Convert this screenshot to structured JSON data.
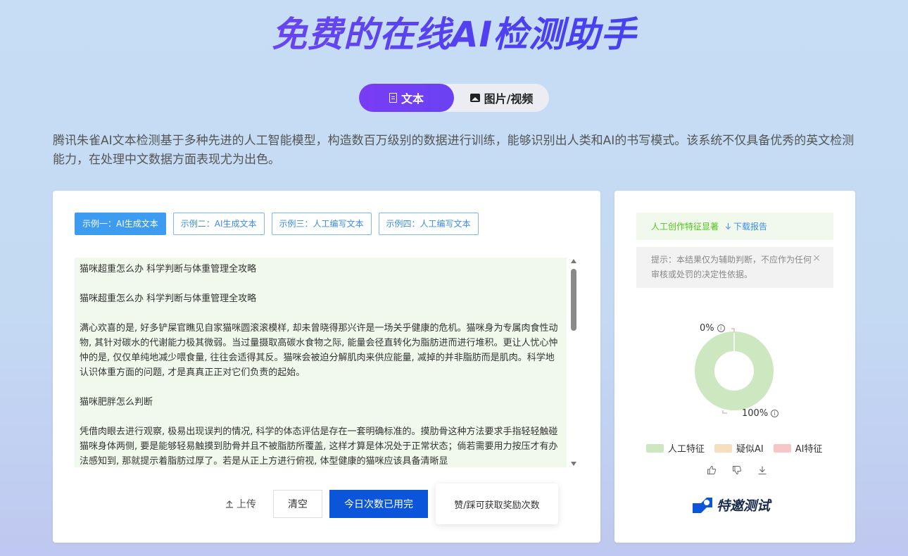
{
  "hero": {
    "title": "免费的在线AI检测助手"
  },
  "mode_tabs": [
    {
      "label": "文本",
      "icon": "document-icon",
      "active": true
    },
    {
      "label": "图片/视频",
      "icon": "image-icon",
      "active": false
    }
  ],
  "intro": "腾讯朱雀AI文本检测基于多种先进的人工智能模型，构造数百万级别的数据进行训练，能够识别出人类和AI的书写模式。该系统不仅具备优秀的英文检测能力，在处理中文数据方面表现尤为出色。",
  "examples": [
    {
      "label": "示例一：AI生成文本",
      "active": true
    },
    {
      "label": "示例二：AI生成文本",
      "active": false
    },
    {
      "label": "示例三：人工编写文本",
      "active": false
    },
    {
      "label": "示例四：人工编写文本",
      "active": false
    }
  ],
  "input_text": [
    "猫咪超重怎么办 科学判断与体重管理全攻略",
    "猫咪超重怎么办 科学判断与体重管理全攻略",
    "满心欢喜的是, 好多铲屎官瞧见自家猫咪圆滚滚模样, 却未曾晓得那兴许是一场关乎健康的危机。猫咪身为专属肉食性动物, 其针对碳水的代谢能力极其微弱。当过量摄取高碳水食物之际, 能量会径直转化为脂肪进而进行堆积。更让人忧心忡忡的是, 仅仅单纯地减少喂食量, 往往会适得其反。猫咪会被迫分解肌肉来供应能量, 减掉的并非脂肪而是肌肉。科学地认识体重方面的问题, 才是真真正正对它们负责的起始。",
    "猫咪肥胖怎么判断",
    "凭借肉眼去进行观察, 极易出现误判的情况, 科学的体态评估是存在一套明确标准的。摸肋骨这种方法要求手指轻轻触碰猫咪身体两侧, 要是能够轻易触摸到肋骨并且不被脂肪所覆盖, 这样才算是体况处于正常状态；倘若需要用力按压才有办法感知到, 那就提示着脂肪过厚了。若是从正上方进行俯视, 体型健康的猫咪应该具备清晰显"
  ],
  "actions": {
    "upload": "上传",
    "clear": "清空",
    "quota": "今日次数已用完",
    "reward_tip": "赞/踩可获取奖励次数"
  },
  "result": {
    "verdict": "人工创作特征显著",
    "download": "下载报告",
    "hint": "提示：本结果仅为辅助判断，不应作为任何审核或处罚的决定性依据。",
    "hint_close": "×",
    "ai_label": "0%",
    "human_label": "100%"
  },
  "legend": [
    {
      "label": "人工特征",
      "color": "#cde8c0"
    },
    {
      "label": "疑似AI",
      "color": "#f5dfbd"
    },
    {
      "label": "AI特征",
      "color": "#f7c7c7"
    }
  ],
  "brand": {
    "name": "特邀测试"
  },
  "colors": {
    "accent_purple": "#6a42f3",
    "primary_blue": "#0a55d9",
    "example_blue": "#3d9bf0",
    "success_green": "#52c41a",
    "text_bg": "#f1f9ec"
  }
}
